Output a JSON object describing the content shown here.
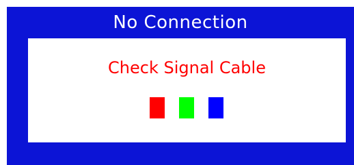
{
  "osd": {
    "title": "No Connection",
    "message": "Check Signal Cable",
    "colors": {
      "frame": "#0c14d6",
      "panel": "#ffffff",
      "title_text": "#ffffff",
      "message_text": "#ff0000"
    },
    "swatches": [
      {
        "name": "red",
        "color": "#ff0000"
      },
      {
        "name": "green",
        "color": "#00ff00"
      },
      {
        "name": "blue",
        "color": "#0000ff"
      }
    ]
  }
}
